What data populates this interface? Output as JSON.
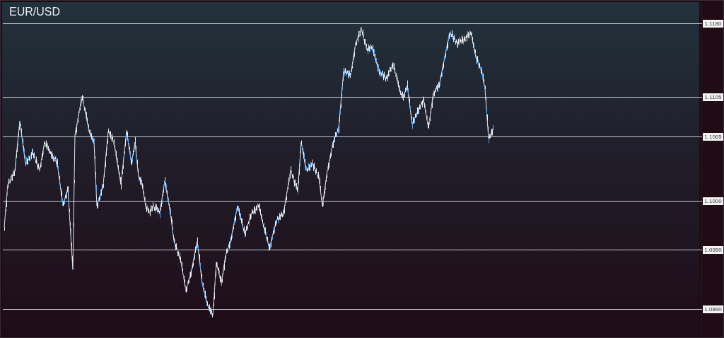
{
  "chart": {
    "title": "EUR/USD",
    "levels": [
      {
        "label": "1.1180"
      },
      {
        "label": "1.1105"
      },
      {
        "label": "1.1065"
      },
      {
        "label": "1.1000"
      },
      {
        "label": "1.0950"
      },
      {
        "label": "1.0890"
      }
    ]
  }
}
